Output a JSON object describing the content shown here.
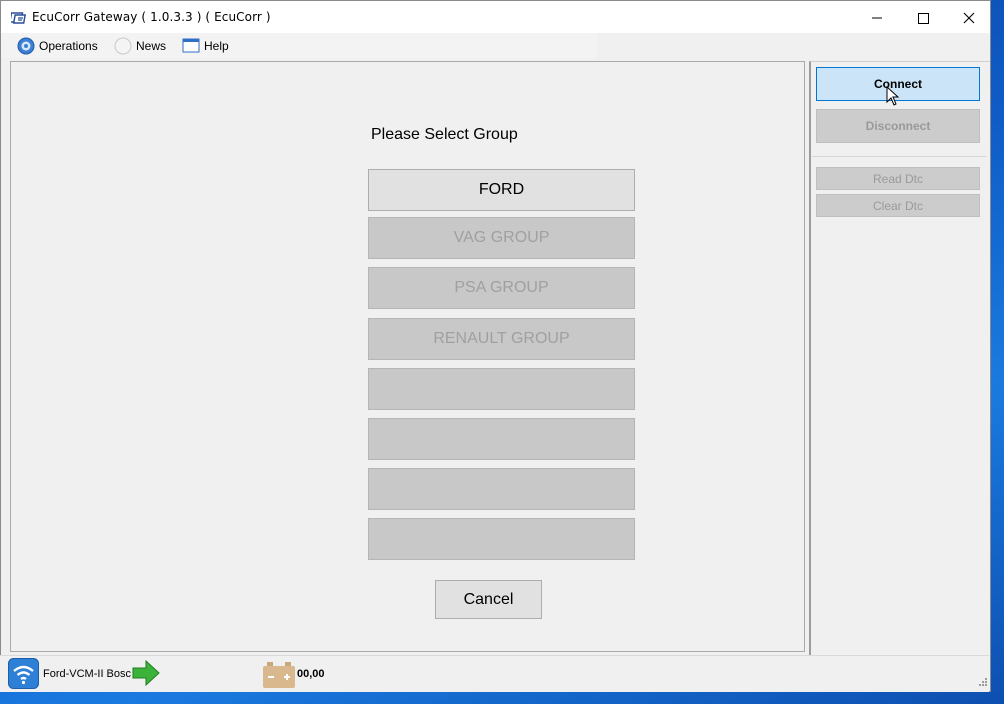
{
  "window": {
    "title": "EcuCorr Gateway ( 1.0.3.3 ) ( EcuCorr )"
  },
  "menu": {
    "items": [
      {
        "label": "Operations",
        "icon": "globe-icon"
      },
      {
        "label": "News",
        "icon": "news-icon"
      },
      {
        "label": "Help",
        "icon": "window-icon"
      }
    ]
  },
  "main": {
    "prompt": "Please Select Group",
    "groups": [
      {
        "label": "FORD",
        "enabled": true
      },
      {
        "label": "VAG GROUP",
        "enabled": false
      },
      {
        "label": "PSA GROUP",
        "enabled": false
      },
      {
        "label": "RENAULT GROUP",
        "enabled": false
      },
      {
        "label": "",
        "enabled": false
      },
      {
        "label": "",
        "enabled": false
      },
      {
        "label": "",
        "enabled": false
      },
      {
        "label": "",
        "enabled": false
      }
    ],
    "cancel_label": "Cancel"
  },
  "side": {
    "connect_label": "Connect",
    "disconnect_label": "Disconnect",
    "read_dtc_label": "Read Dtc",
    "clear_dtc_label": "Clear Dtc"
  },
  "status": {
    "device": "Ford-VCM-II Bosc",
    "voltage": "00,00"
  },
  "colors": {
    "accent": "#0078d7",
    "connect_bg": "#cce4f7",
    "disabled_bg": "#c8c8c8"
  }
}
